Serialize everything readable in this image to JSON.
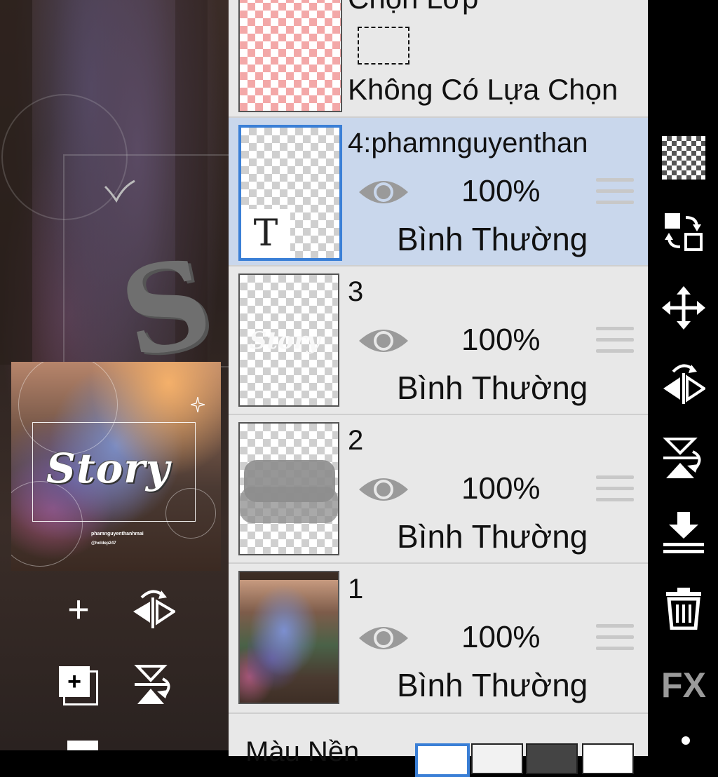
{
  "canvas": {
    "preview": {
      "title": "Story",
      "credit_line_1": "phamnguyenthanhmai",
      "credit_line_2": "@holdep247"
    }
  },
  "layer_panel": {
    "selection_layer": {
      "title": "Chọn Lớp",
      "status": "Không Có Lựa Chọn"
    },
    "layers": [
      {
        "name": "4:phamnguyenthan",
        "opacity": "100%",
        "blend_mode": "Bình Thường",
        "selected": true,
        "type": "text",
        "text_badge": "T"
      },
      {
        "name": "3",
        "opacity": "100%",
        "blend_mode": "Bình Thường",
        "selected": false,
        "type": "text-graphic",
        "ghost": "Story"
      },
      {
        "name": "2",
        "opacity": "100%",
        "blend_mode": "Bình Thường",
        "selected": false,
        "type": "brush"
      },
      {
        "name": "1",
        "opacity": "100%",
        "blend_mode": "Bình Thường",
        "selected": false,
        "type": "photo"
      }
    ],
    "background": {
      "label": "Màu Nền",
      "swatches": [
        "white",
        "transparent",
        "dark-checker",
        "none"
      ]
    }
  },
  "left_tools": [
    "add-layer-icon",
    "flip-horizontal-icon",
    "copy-layer-icon",
    "flip-vertical-icon",
    "delete-icon"
  ],
  "right_toolbar": {
    "icons": [
      "checker-icon",
      "swap-layer-icon",
      "move-icon",
      "flip-horizontal-icon",
      "flip-vertical-icon",
      "merge-down-icon",
      "trash-icon"
    ],
    "fx_label": "FX"
  },
  "colors": {
    "panel_bg": "#e8e8e8",
    "selected_row_bg": "#c9d7ec",
    "selected_border": "#3a7fd6",
    "toolbar_bg": "#000000",
    "fx_gray": "#9a9a9a"
  }
}
